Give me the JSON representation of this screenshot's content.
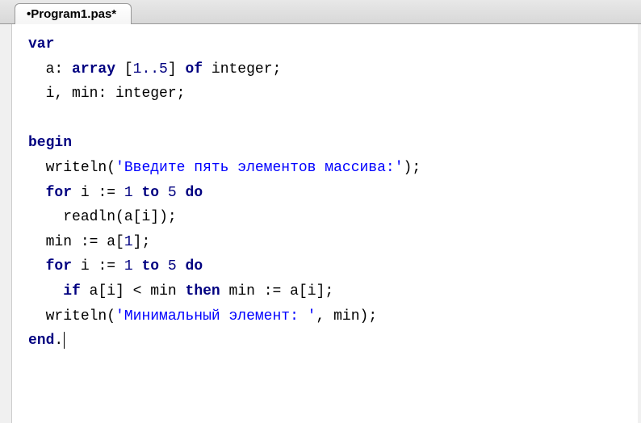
{
  "tab": {
    "label": "•Program1.pas*"
  },
  "code": {
    "l1_kw_var": "var",
    "l2_id_a": "a",
    "l2_kw_array": "array",
    "l2_range": "1..5",
    "l2_kw_of": "of",
    "l2_type_int": "integer",
    "l3_id_i": "i",
    "l3_id_min": "min",
    "l3_type_int": "integer",
    "l5_kw_begin": "begin",
    "l6_fn_writeln": "writeln",
    "l6_str": "'Введите пять элементов массива:'",
    "l7_kw_for": "for",
    "l7_id_i": "i",
    "l7_num_1": "1",
    "l7_kw_to": "to",
    "l7_num_5": "5",
    "l7_kw_do": "do",
    "l8_fn_readln": "readln",
    "l8_id_a": "a",
    "l8_id_i": "i",
    "l9_id_min": "min",
    "l9_id_a": "a",
    "l9_num_1": "1",
    "l10_kw_for": "for",
    "l10_id_i": "i",
    "l10_num_1": "1",
    "l10_kw_to": "to",
    "l10_num_5": "5",
    "l10_kw_do": "do",
    "l11_kw_if": "if",
    "l11_id_a": "a",
    "l11_id_i": "i",
    "l11_id_min": "min",
    "l11_kw_then": "then",
    "l11_id_min2": "min",
    "l11_id_a2": "a",
    "l11_id_i2": "i",
    "l12_fn_writeln": "writeln",
    "l12_str": "'Минимальный элемент: '",
    "l12_id_min": "min",
    "l13_kw_end": "end"
  }
}
